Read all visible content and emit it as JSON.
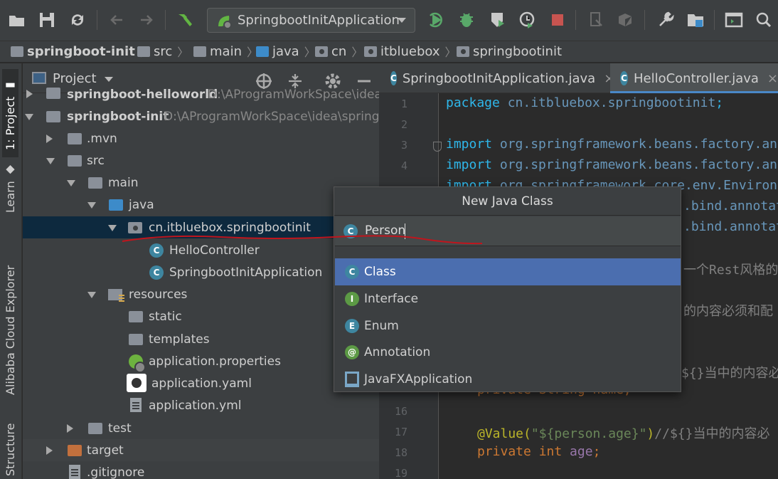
{
  "toolbar": {
    "run_config": "SpringbootInitApplication",
    "icons": [
      "open-folder-icon",
      "save-icon",
      "sync-icon",
      "back-icon",
      "forward-icon",
      "build-hammer-icon",
      "run-icon",
      "debug-icon",
      "coverage-icon",
      "profile-icon",
      "stop-icon",
      "attach-icon",
      "project-structure-icon",
      "settings-wrench-icon",
      "sdk-icon",
      "terminal-icon",
      "search-icon"
    ]
  },
  "breadcrumb": [
    "springboot-init",
    "src",
    "main",
    "java",
    "cn",
    "itbluebox",
    "springbootinit"
  ],
  "left_stripe": {
    "project": "1: Project",
    "learn": "Learn",
    "cloud": "Alibaba Cloud Explorer",
    "structure": "Structure"
  },
  "project_panel": {
    "title": "Project",
    "tree": [
      {
        "label": "springboot-helloworld",
        "path": "D:\\AProgramWorkSpace\\idea"
      },
      {
        "label": "springboot-init",
        "path": "D:\\AProgramWorkSpace\\idea\\springb"
      },
      {
        "label": ".mvn"
      },
      {
        "label": "src"
      },
      {
        "label": "main"
      },
      {
        "label": "java"
      },
      {
        "label": "cn.itbluebox.springbootinit"
      },
      {
        "label": "HelloController"
      },
      {
        "label": "SpringbootInitApplication"
      },
      {
        "label": "resources"
      },
      {
        "label": "static"
      },
      {
        "label": "templates"
      },
      {
        "label": "application.properties"
      },
      {
        "label": "application.yaml"
      },
      {
        "label": "application.yml"
      },
      {
        "label": "test"
      },
      {
        "label": "target"
      },
      {
        "label": ".gitignore"
      }
    ]
  },
  "editor": {
    "tabs": [
      {
        "label": "SpringbootInitApplication.java",
        "close": "×"
      },
      {
        "label": "HelloController.java",
        "close": "×"
      }
    ],
    "line_numbers": [
      "1",
      "2",
      "3",
      "4",
      "16",
      "17",
      "18",
      "19"
    ],
    "code": {
      "l1_kw": "package",
      "l1_pkg": " cn.itbluebox.springbootinit",
      "l1_end": ";",
      "l3_kw": "import",
      "l3_pkg": " org.springframework.beans.factory.an",
      "l4_kw": "import",
      "l4_pkg": " org.springframework.beans.factory.an",
      "l5_kw": "import",
      "l5_pkg": " org.springframework.core.env.Environ",
      "l6_pkg": ".bind.annotat",
      "l7_pkg": ".bind.annotat",
      "l8_cmt": "一个Rest风格的",
      "l9_cmt": "的内容必须和配",
      "l10_cmt": "${}当中的内容必",
      "l15_code": "private String name;",
      "l17_ann": "@Value(",
      "l17_str": "\"${person.age}\"",
      "l17_rest": ")",
      "l17_cmt": "//${}当中的内容必",
      "l18_kw": "private",
      "l18_type": " int",
      "l18_fld": " age",
      "l18_end": ";"
    }
  },
  "popup": {
    "title": "New Java Class",
    "input_value": "Person",
    "kinds": [
      {
        "badge": "C",
        "label": "Class",
        "color": "#3e86a0"
      },
      {
        "badge": "I",
        "label": "Interface",
        "color": "#5c9a45"
      },
      {
        "badge": "E",
        "label": "Enum",
        "color": "#3e86a0"
      },
      {
        "badge": "@",
        "label": "Annotation",
        "color": "#5c9a45"
      },
      {
        "badge": "",
        "label": "JavaFXApplication",
        "color": "#7aa7c7"
      }
    ]
  },
  "colors": {
    "accent": "#4b6eaf",
    "annotation_red": "#c0151d"
  }
}
